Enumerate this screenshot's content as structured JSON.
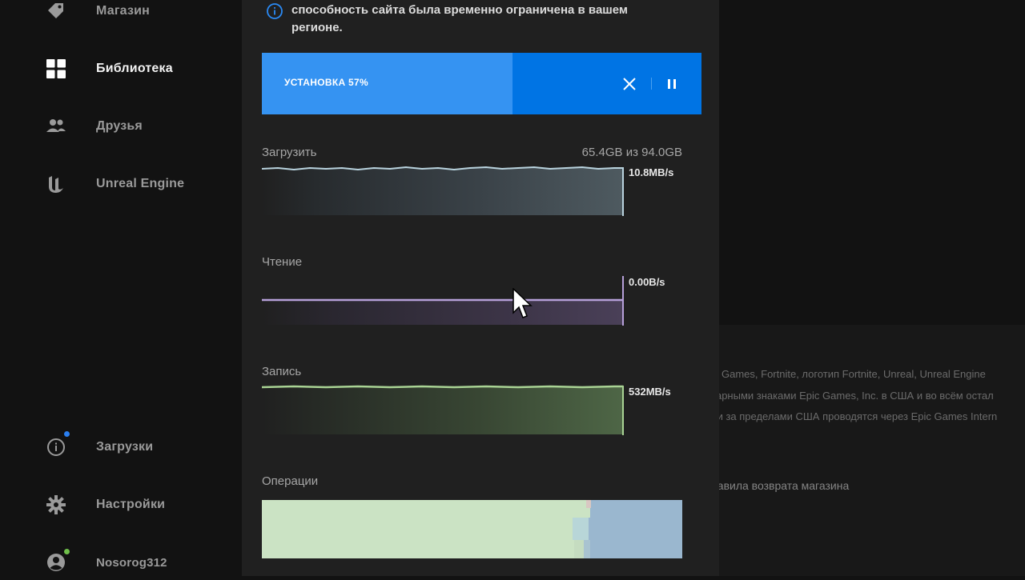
{
  "sidebar": {
    "items": [
      {
        "label": "Магазин",
        "icon": "tag-icon"
      },
      {
        "label": "Библиотека",
        "icon": "grid-icon"
      },
      {
        "label": "Друзья",
        "icon": "friends-icon"
      },
      {
        "label": "Unreal Engine",
        "icon": "unreal-logo-icon"
      }
    ],
    "bottom_items": [
      {
        "label": "Загрузки",
        "icon": "info-icon"
      },
      {
        "label": "Настройки",
        "icon": "gear-icon"
      },
      {
        "label": "Nosorog312",
        "icon": "user-icon"
      }
    ]
  },
  "panel": {
    "notice": "способность сайта была временно ограничена в вашем регионе.",
    "install": {
      "label": "УСТАНОВКА 57%",
      "progress": 0.57
    },
    "download": {
      "title": "Загрузить",
      "size": "65.4GB из 94.0GB",
      "rate": "10.8MB/s"
    },
    "read": {
      "title": "Чтение",
      "rate": "0.00B/s"
    },
    "write": {
      "title": "Запись",
      "rate": "532MB/s"
    },
    "operations": {
      "title": "Операции"
    }
  },
  "background": {
    "legal_lines": [
      "ic Games, Fortnite, логотип Fortnite, Unreal, Unreal Engine",
      "зарными знаками Epic Games, Inc. в США и во всём остал",
      "ли за пределами США проводятся через Epic Games Intern"
    ],
    "refund_link": "равила возврата магазина"
  },
  "colors": {
    "accent": "#0074e4",
    "accent_fill": "#3593f2",
    "download_line": "#b9d3de",
    "read_line": "#b6a0d9",
    "write_line": "#a9d394",
    "ops_green": "#cbe3c4",
    "ops_blue": "#9ab7cf",
    "notify_blue": "#2a7ff0",
    "online_green": "#6fbf4a"
  }
}
